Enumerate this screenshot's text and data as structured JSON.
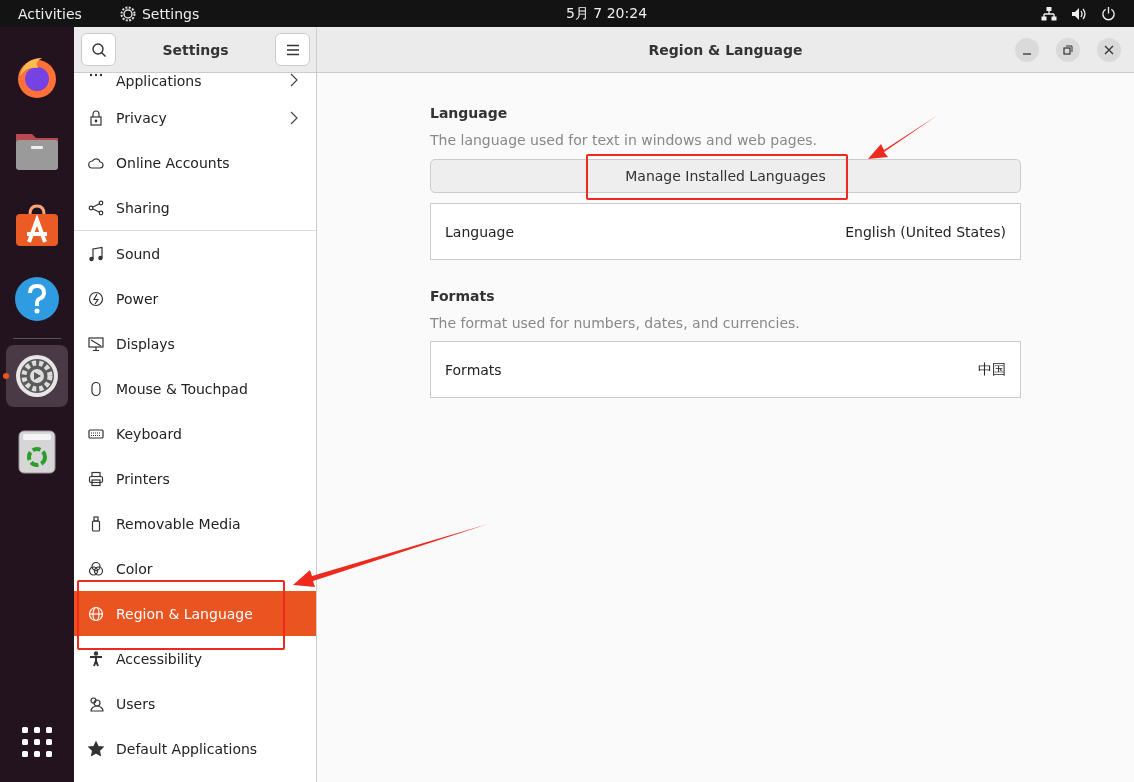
{
  "top_bar": {
    "activities": "Activities",
    "app_name": "Settings",
    "clock": "5月 7  20:24"
  },
  "dock": [
    {
      "kind": "firefox",
      "selected": false
    },
    {
      "kind": "files",
      "selected": false
    },
    {
      "kind": "store",
      "selected": false
    },
    {
      "kind": "help",
      "selected": false
    },
    {
      "kind": "settings",
      "selected": true
    },
    {
      "kind": "trash",
      "selected": false
    }
  ],
  "sidebar": {
    "title": "Settings",
    "groups": [
      [
        {
          "kind": "dots",
          "label": "Applications",
          "arrow": true,
          "selected": false
        },
        {
          "kind": "lock",
          "label": "Privacy",
          "arrow": true,
          "selected": false
        },
        {
          "kind": "cloud",
          "label": "Online Accounts",
          "arrow": false,
          "selected": false
        },
        {
          "kind": "share",
          "label": "Sharing",
          "arrow": false,
          "selected": false
        }
      ],
      [
        {
          "kind": "note",
          "label": "Sound",
          "arrow": false,
          "selected": false
        },
        {
          "kind": "power",
          "label": "Power",
          "arrow": false,
          "selected": false
        },
        {
          "kind": "display",
          "label": "Displays",
          "arrow": false,
          "selected": false
        },
        {
          "kind": "mouse",
          "label": "Mouse & Touchpad",
          "arrow": false,
          "selected": false
        },
        {
          "kind": "keyboard",
          "label": "Keyboard",
          "arrow": false,
          "selected": false
        },
        {
          "kind": "printer",
          "label": "Printers",
          "arrow": false,
          "selected": false
        },
        {
          "kind": "usb",
          "label": "Removable Media",
          "arrow": false,
          "selected": false
        },
        {
          "kind": "color",
          "label": "Color",
          "arrow": false,
          "selected": false
        },
        {
          "kind": "globe",
          "label": "Region & Language",
          "arrow": false,
          "selected": true
        },
        {
          "kind": "person",
          "label": "Accessibility",
          "arrow": false,
          "selected": false
        },
        {
          "kind": "users",
          "label": "Users",
          "arrow": false,
          "selected": false
        },
        {
          "kind": "star",
          "label": "Default Applications",
          "arrow": false,
          "selected": false
        }
      ]
    ]
  },
  "window": {
    "title": "Region & Language"
  },
  "sections": [
    {
      "heading": "Language",
      "description": "The language used for text in windows and web pages.",
      "button": "Manage Installed Languages",
      "row": {
        "label": "Language",
        "value": "English (United States)"
      }
    },
    {
      "heading": "Formats",
      "description": "The format used for numbers, dates, and currencies.",
      "row": {
        "label": "Formats",
        "value": "中国"
      }
    }
  ]
}
